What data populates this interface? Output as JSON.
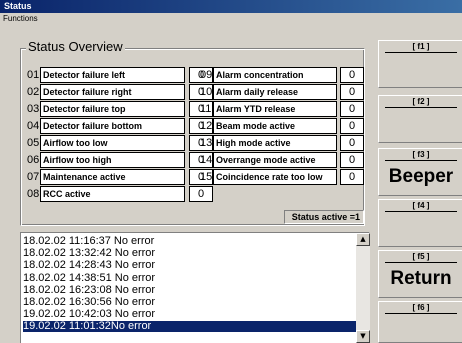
{
  "window": {
    "title": "Status"
  },
  "menu": {
    "functions": "Functions"
  },
  "overview": {
    "title": "Status Overview",
    "left": [
      {
        "num": "01",
        "label": "Detector failure left",
        "value": "0"
      },
      {
        "num": "02",
        "label": "Detector failure right",
        "value": "0"
      },
      {
        "num": "03",
        "label": "Detector failure top",
        "value": "0"
      },
      {
        "num": "04",
        "label": "Detector failure bottom",
        "value": "0"
      },
      {
        "num": "05",
        "label": "Airflow too low",
        "value": "0"
      },
      {
        "num": "06",
        "label": "Airflow too high",
        "value": "0"
      },
      {
        "num": "07",
        "label": "Maintenance active",
        "value": "0"
      },
      {
        "num": "08",
        "label": "RCC active",
        "value": "0"
      }
    ],
    "right": [
      {
        "num": "09",
        "label": "Alarm concentration",
        "value": "0"
      },
      {
        "num": "10",
        "label": "Alarm daily release",
        "value": "0"
      },
      {
        "num": "11",
        "label": "Alarm YTD release",
        "value": "0"
      },
      {
        "num": "12",
        "label": "Beam mode active",
        "value": "0"
      },
      {
        "num": "13",
        "label": "High mode active",
        "value": "0"
      },
      {
        "num": "14",
        "label": "Overrange mode active",
        "value": "0"
      },
      {
        "num": "15",
        "label": "Coincidence rate too low",
        "value": "0"
      }
    ],
    "status_active": "Status active =1"
  },
  "log": {
    "entries": [
      "18.02.02 11:16:37 No error",
      "18.02.02 13:32:42 No error",
      "18.02.02 14:28:43 No error",
      "18.02.02 14:38:51 No error",
      "18.02.02 16:23:08 No error",
      "18.02.02 16:30:56 No error",
      "19.02.02 10:42:03 No error",
      "19.02.02 11:01:32No error"
    ],
    "selected_index": 7
  },
  "fkeys": [
    {
      "key": "[ f1 ]",
      "name": ""
    },
    {
      "key": "[ f2 ]",
      "name": ""
    },
    {
      "key": "[ f3 ]",
      "name": "Beeper"
    },
    {
      "key": "[ f4 ]",
      "name": ""
    },
    {
      "key": "[ f5 ]",
      "name": "Return"
    },
    {
      "key": "[ f6 ]",
      "name": ""
    }
  ],
  "icons": {
    "scroll_up": "scroll-up-arrow",
    "scroll_down": "scroll-down-arrow"
  },
  "colors": {
    "titlebar": "#0a246a",
    "selection": "#0a246a",
    "face": "#d4d0c8"
  }
}
